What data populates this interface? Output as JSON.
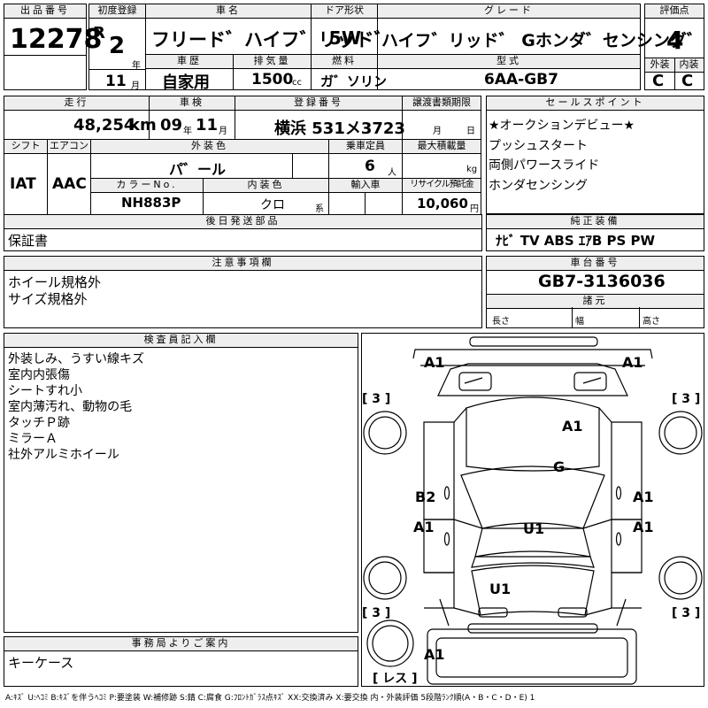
{
  "lot": {
    "label": "出品番号",
    "value": "12278"
  },
  "first_reg": {
    "label": "初度登録",
    "era": "R",
    "year": "2",
    "year_unit": "年",
    "month": "11",
    "month_unit": "月"
  },
  "car_name": {
    "label": "車名",
    "value": "フリード゛ハイフ゛リッド゛"
  },
  "door": {
    "label": "ドア形状",
    "value": "5W"
  },
  "grade": {
    "label": "グレード",
    "value": "ハイフ゛リッド゛ Gホンダ゛センシング゛"
  },
  "score": {
    "label": "評価点",
    "value": "4",
    "ext_label": "外装",
    "int_label": "内装",
    "ext": "C",
    "int": "C"
  },
  "history": {
    "label": "車歴",
    "value": "自家用"
  },
  "displacement": {
    "label": "排気量",
    "value": "1500",
    "unit": "cc"
  },
  "fuel": {
    "label": "燃料",
    "value": "ガ゛ソリン"
  },
  "model": {
    "label": "型式",
    "value": "6AA-GB7"
  },
  "mileage": {
    "label": "走行",
    "value": "48,254",
    "unit": "km"
  },
  "inspection": {
    "label": "車検",
    "year": "09",
    "year_unit": "年",
    "month": "11",
    "month_unit": "月"
  },
  "registration": {
    "label": "登録番号",
    "value": "横浜 531メ3723"
  },
  "transfer": {
    "label": "譲渡書類期限",
    "month_unit": "月",
    "day_unit": "日"
  },
  "sales_points": {
    "label": "セールスポイント",
    "items": [
      "★オークションデビュー★",
      "プッシュスタート",
      "両側パワースライド",
      "ホンダセンシング"
    ]
  },
  "shift": {
    "label": "シフト",
    "value": "IAT"
  },
  "ac": {
    "label": "エアコン",
    "value": "AAC"
  },
  "exterior_color": {
    "label": "外装色",
    "value": "パ゛ール"
  },
  "capacity": {
    "label": "乗車定員",
    "value": "6",
    "unit": "人"
  },
  "max_load": {
    "label": "最大積載量",
    "unit": "kg"
  },
  "color_no": {
    "label": "カラーNo.",
    "value": "NH883P"
  },
  "interior_color": {
    "label": "内装色",
    "value": "クロ",
    "unit": "系"
  },
  "import": {
    "label": "輸入車"
  },
  "recycle": {
    "label": "リサイクル預託金",
    "value": "10,060",
    "unit": "円"
  },
  "later_parts": {
    "label": "後日発送部品",
    "value": "保証書"
  },
  "genuine": {
    "label": "純正装備",
    "value": "ﾅﾋﾞ TV ABS ｴｱB PS PW"
  },
  "notes": {
    "label": "注意事項欄",
    "lines": [
      "ホイール規格外",
      "サイズ規格外"
    ]
  },
  "chassis": {
    "label": "車台番号",
    "value": "GB7-3136036",
    "spec_label": "諸元",
    "length": "長さ",
    "width": "幅",
    "height": "高さ"
  },
  "inspector": {
    "label": "検査員記入欄",
    "lines": [
      "外装しみ、うすい線キズ",
      "室内内張傷",
      "シートすれ小",
      "室内薄汚れ、動物の毛",
      "タッチＰ跡",
      "ミラーＡ",
      "社外アルミホイール"
    ]
  },
  "office": {
    "label": "事務局よりご案内",
    "value": "キーケース"
  },
  "legend": "A:ｷｽﾞ U:ﾍｺﾐ B:ｷｽﾞを伴うﾍｺﾐ P:要塗装 W:補修跡 S:錆 C:腐食 G:ﾌﾛﾝﾄｶﾞﾗｽ点ｷｽﾞ XX:交換済み X:要交換 内・外装評価 5段階ﾗﾝｸ順(A・B・C・D・E) 1",
  "chart_data": {
    "type": "diagram",
    "marks": [
      {
        "code": "A1",
        "area": "front-left-corner"
      },
      {
        "code": "A1",
        "area": "front-right-corner"
      },
      {
        "code": "A1",
        "area": "hood"
      },
      {
        "code": "G",
        "area": "windshield"
      },
      {
        "code": "B2",
        "area": "left-front-door"
      },
      {
        "code": "A1",
        "area": "right-front-door"
      },
      {
        "code": "A1",
        "area": "left-rear-door"
      },
      {
        "code": "A1",
        "area": "right-rear-door"
      },
      {
        "code": "U1",
        "area": "roof"
      },
      {
        "code": "U1",
        "area": "rear-glass"
      },
      {
        "code": "A1",
        "area": "spare-tire"
      }
    ],
    "tire_marks": [
      "[ 3 ]",
      "[ 3 ]",
      "[ 3 ]",
      "[ 3 ]"
    ],
    "spare": "[ レス ]"
  }
}
